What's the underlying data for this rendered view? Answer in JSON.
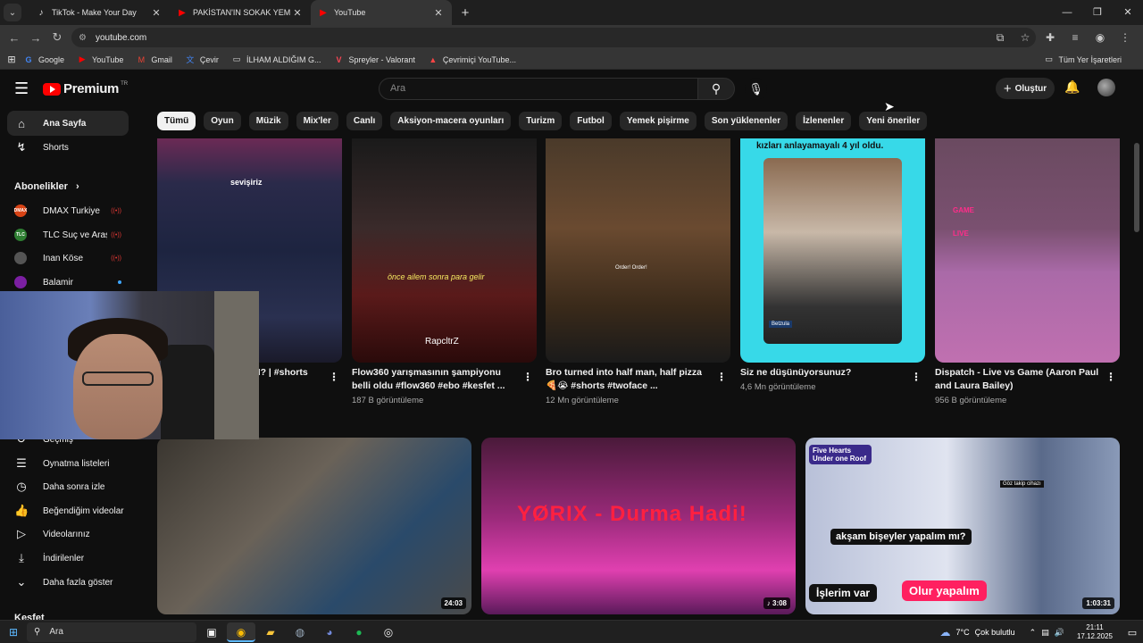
{
  "browser": {
    "tabs": [
      {
        "title": "TikTok - Make Your Day",
        "icon": "tiktok-icon",
        "active": false
      },
      {
        "title": "PAKİSTAN'IN SOKAK YEMEKLERİ",
        "icon": "youtube-icon",
        "active": false
      },
      {
        "title": "YouTube",
        "icon": "youtube-icon",
        "active": true
      }
    ],
    "url": "youtube.com",
    "bookmarks": [
      {
        "label": "Google",
        "icon": "google-icon"
      },
      {
        "label": "YouTube",
        "icon": "youtube-icon"
      },
      {
        "label": "Gmail",
        "icon": "gmail-icon"
      },
      {
        "label": "Çevir",
        "icon": "translate-icon"
      },
      {
        "label": "İLHAM ALDIĞIM G...",
        "icon": "folder-icon"
      },
      {
        "label": "Spreyler - Valorant",
        "icon": "valorant-icon"
      },
      {
        "label": "Çevrimiçi YouTube...",
        "icon": "bookmark-icon"
      }
    ],
    "all_bookmarks": "Tüm Yer İşaretleri"
  },
  "youtube": {
    "logo_text": "Premium",
    "logo_region": "TR",
    "search_placeholder": "Ara",
    "create_label": "Oluştur",
    "sidebar": {
      "home": "Ana Sayfa",
      "shorts": "Shorts",
      "subscriptions_header": "Abonelikler",
      "subscriptions": [
        {
          "name": "DMAX Turkiye",
          "status": "live"
        },
        {
          "name": "TLC Suç ve Araşt...",
          "status": "live"
        },
        {
          "name": "İnan Köse",
          "status": "live"
        },
        {
          "name": "Balamir",
          "status": "new"
        }
      ],
      "library": [
        {
          "label": "Geçmiş",
          "icon": "history-icon"
        },
        {
          "label": "Oynatma listeleri",
          "icon": "playlist-icon"
        },
        {
          "label": "Daha sonra izle",
          "icon": "clock-icon"
        },
        {
          "label": "Beğendiğim videolar",
          "icon": "thumbs-up-icon"
        },
        {
          "label": "Videolarınız",
          "icon": "video-icon"
        },
        {
          "label": "İndirilenler",
          "icon": "download-icon"
        },
        {
          "label": "Daha fazla göster",
          "icon": "chevron-down-icon"
        }
      ],
      "explore_header": "Keşfet"
    },
    "chips": [
      "Tümü",
      "Oyun",
      "Müzik",
      "Mix'ler",
      "Canlı",
      "Aksiyon-macera oyunları",
      "Turizm",
      "Futbol",
      "Yemek pişirme",
      "Son yüklenenler",
      "İzlenenler",
      "Yeni öneriler"
    ],
    "shorts": [
      {
        "title": "N? | #shorts",
        "views": "",
        "overlay": "sevişiriz"
      },
      {
        "title": "Flow360 yarışmasının şampiyonu belli oldu #flow360 #ebo #kesfet ...",
        "views": "187 B görüntüleme",
        "overlay": "önce ailem sonra para gelir",
        "overlay2": "RapcltrZ"
      },
      {
        "title": "Bro turned into half man, half pizza 🍕😭 #shorts #twoface ...",
        "views": "12 Mn görüntüleme",
        "overlay": "Order! Order!"
      },
      {
        "title": "Siz ne düşünüyorsunuz?",
        "views": "4,6 Mn görüntüleme",
        "overlay": "kızları anlayamayalı 4 yıl oldu.",
        "overlay2": "Betzula"
      },
      {
        "title": "Dispatch - Live vs Game (Aaron Paul and Laura Bailey)",
        "views": "956 B görüntüleme",
        "overlay": "GAME",
        "overlay2": "LIVE"
      }
    ],
    "videos": [
      {
        "duration": "24:03",
        "overlay": ""
      },
      {
        "duration": "♪ 3:08",
        "overlay": "YØRIX - Durma Hadi!"
      },
      {
        "duration": "1:03:31",
        "overlay": "akşam bişeyler yapalım mı?",
        "badge": "Five Hearts Under one Roof",
        "btn1": "İşlerim var",
        "btn2": "Olur yapalım",
        "tag": "Göz takip cihazı"
      }
    ]
  },
  "taskbar": {
    "search": "Ara",
    "weather_temp": "7°C",
    "weather_desc": "Çok bulutlu",
    "time": "21:11",
    "date": "17.12.2025"
  }
}
